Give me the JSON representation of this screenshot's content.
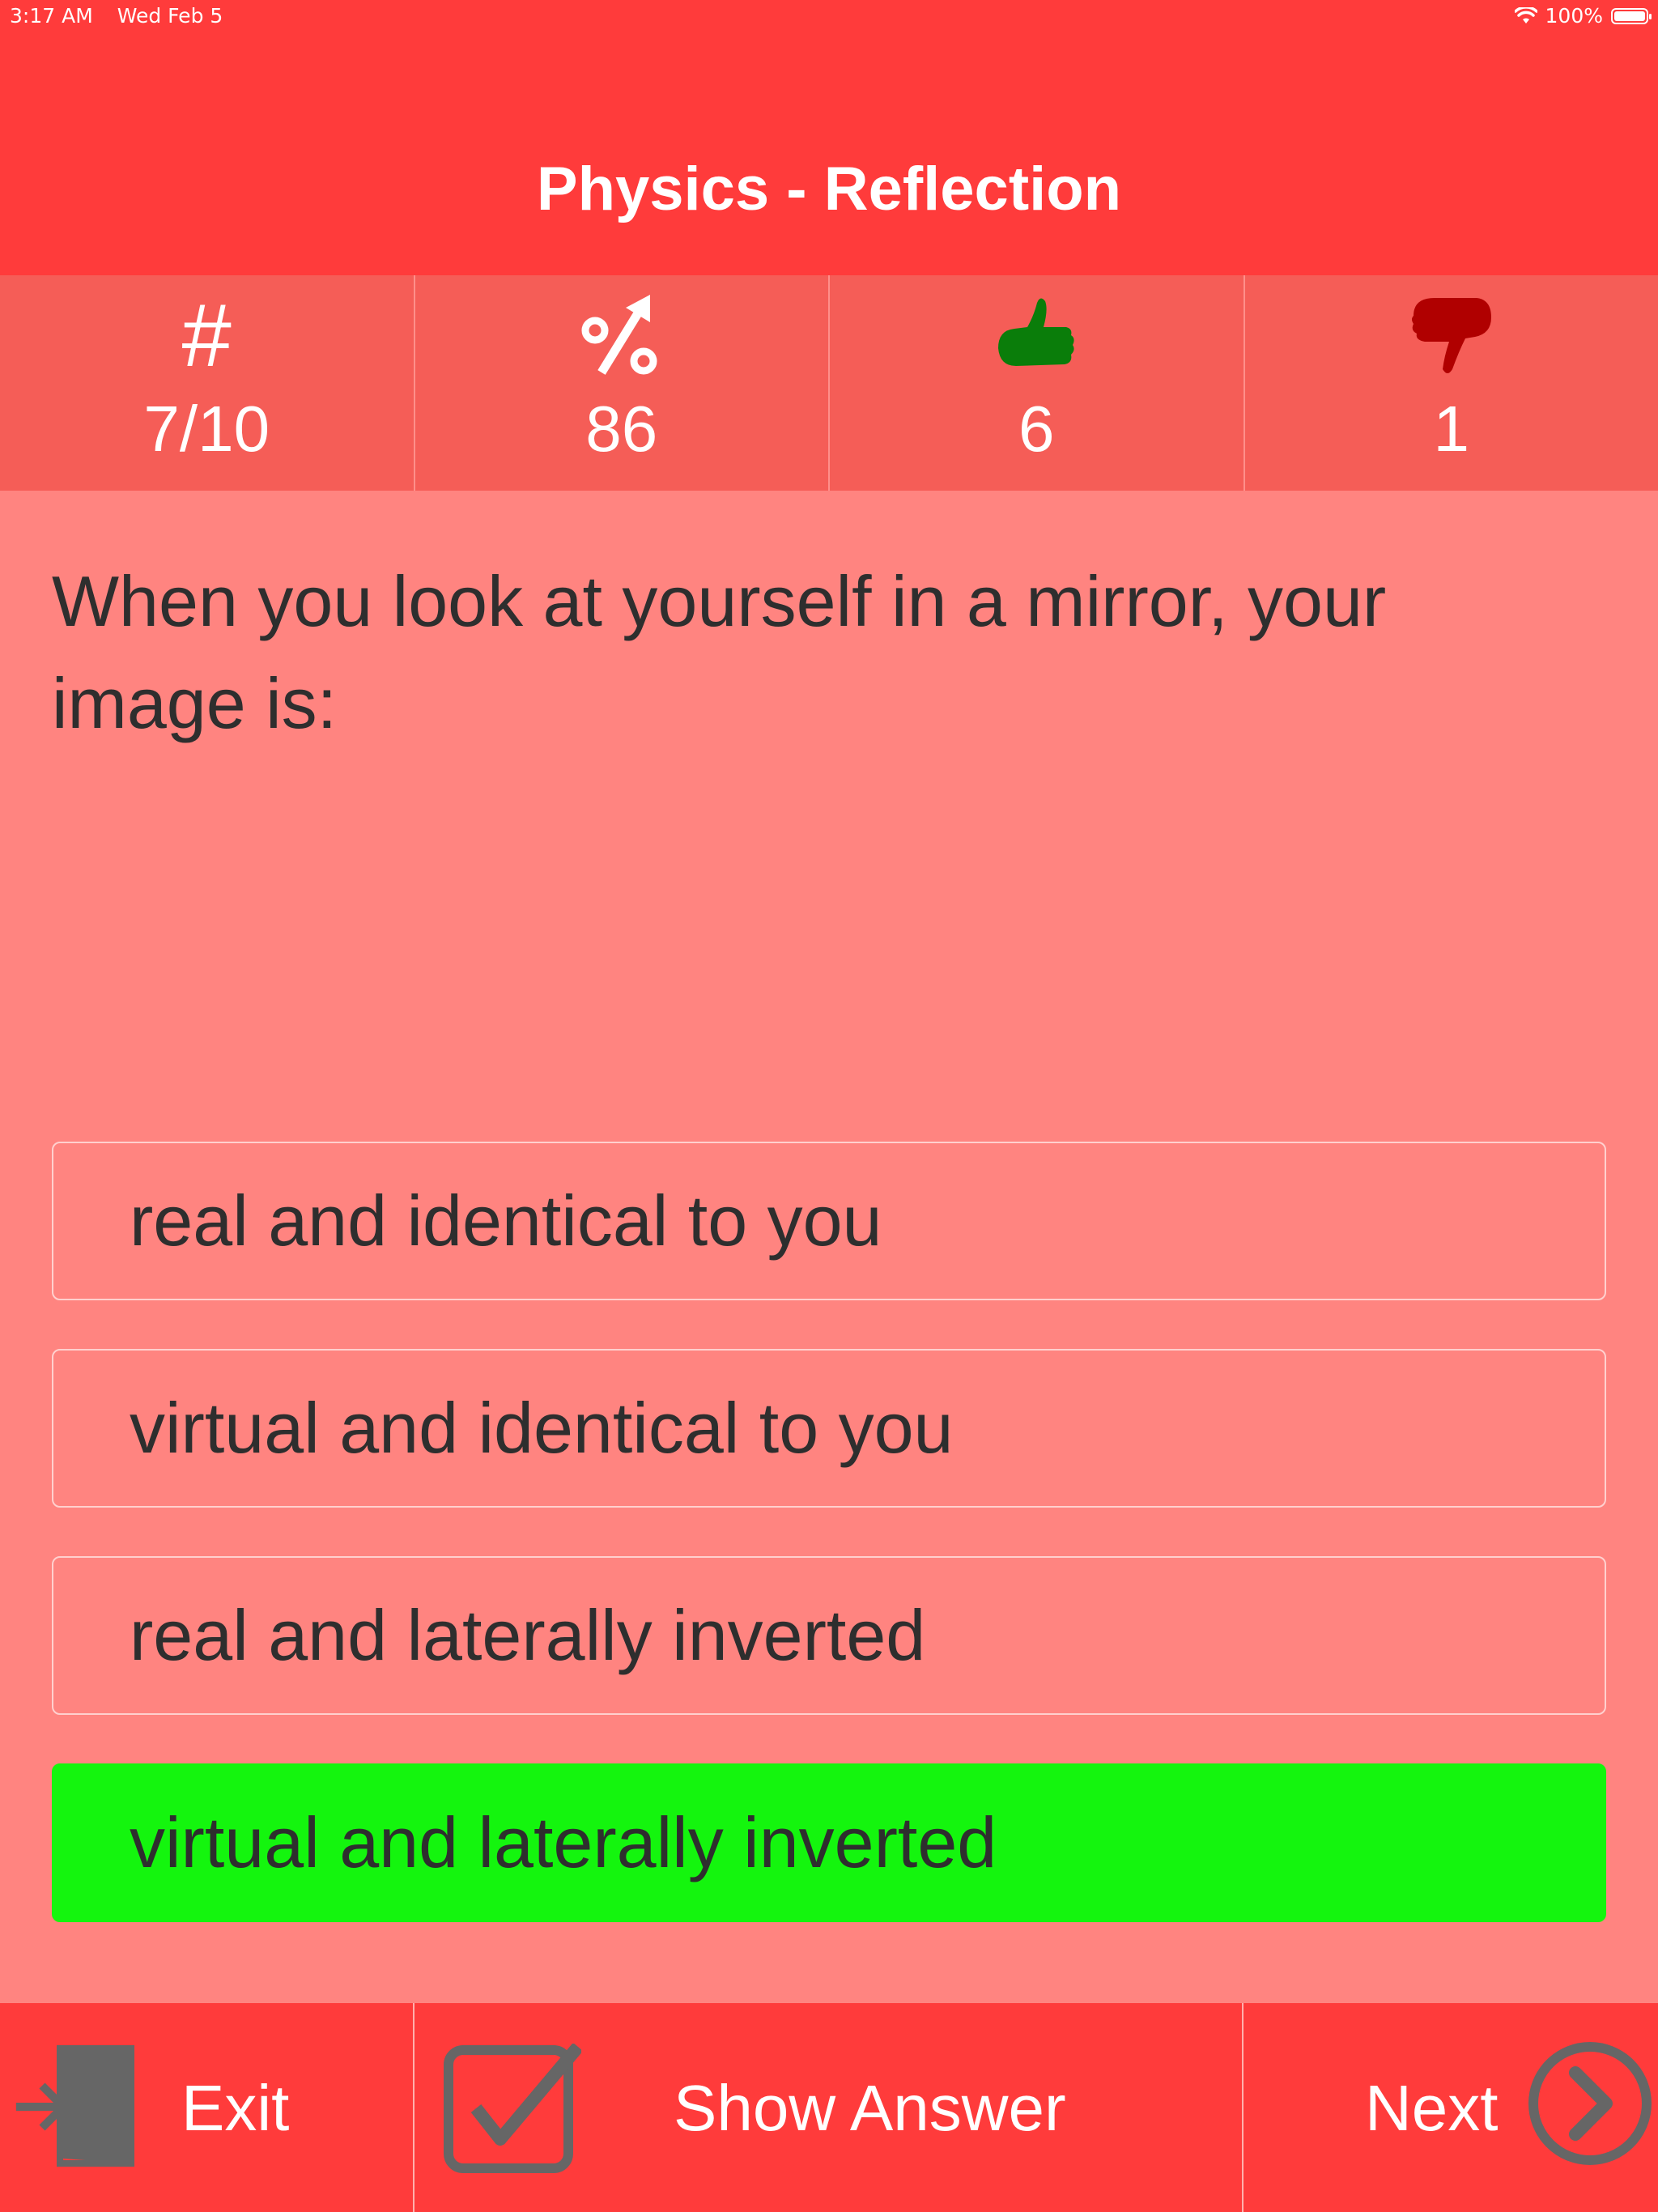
{
  "status_bar": {
    "time": "3:17 AM",
    "date": "Wed Feb 5",
    "battery": "100%"
  },
  "nav": {
    "title": "Physics - Reflection"
  },
  "stats": {
    "progress": {
      "icon": "hash-icon",
      "symbol": "#",
      "value": "7/10"
    },
    "percent": {
      "icon": "percent-up-icon",
      "value": "86"
    },
    "correct": {
      "icon": "thumbs-up-icon",
      "value": "6",
      "color": "#0a7d0a"
    },
    "wrong": {
      "icon": "thumbs-down-icon",
      "value": "1",
      "color": "#b00000"
    }
  },
  "question": {
    "text": "When you look at yourself in a mirror, your image is:"
  },
  "answers": [
    {
      "text": "real and identical to you",
      "state": "default"
    },
    {
      "text": "virtual and identical to you",
      "state": "default"
    },
    {
      "text": "real and laterally inverted",
      "state": "default"
    },
    {
      "text": "virtual and laterally inverted",
      "state": "correct"
    }
  ],
  "toolbar": {
    "exit_label": "Exit",
    "show_answer_label": "Show Answer",
    "next_label": "Next"
  },
  "colors": {
    "header": "#ff3b3b",
    "stats_bg": "#f55d57",
    "content_bg": "#ff8480",
    "correct_answer": "#14f50e",
    "icon_gray": "#666666"
  }
}
